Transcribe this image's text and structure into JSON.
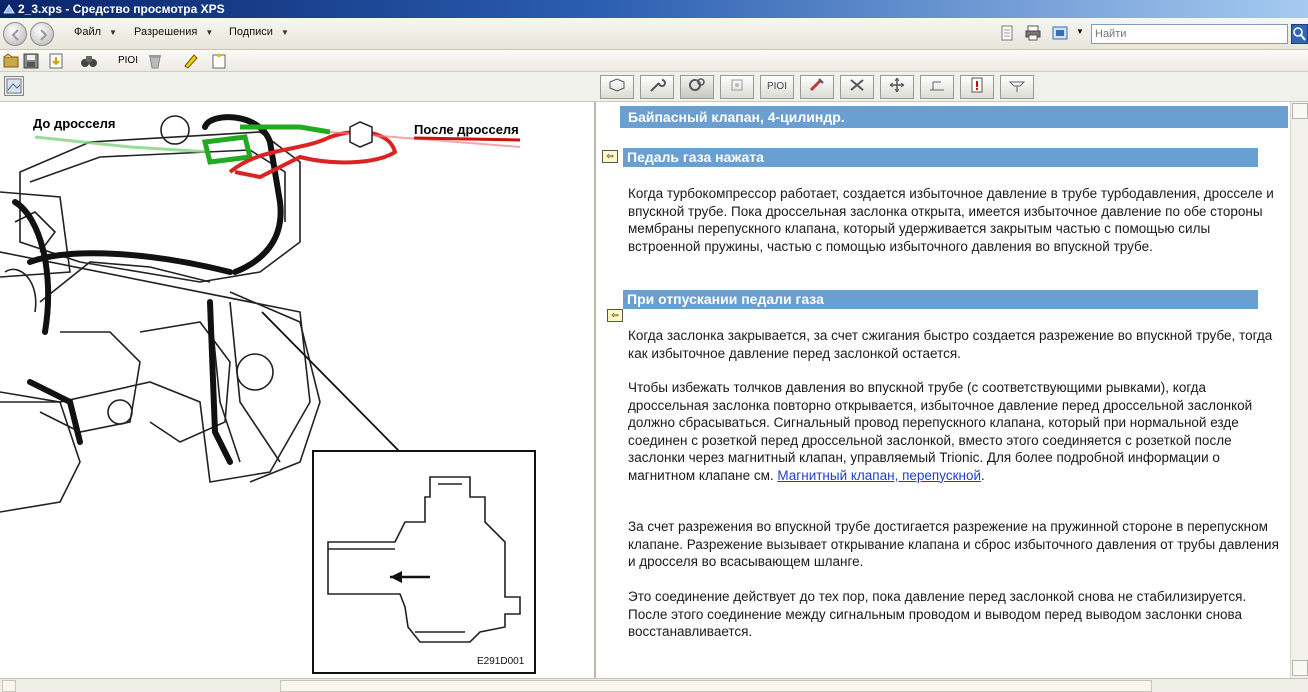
{
  "window": {
    "title": "2_3.xps - Средство просмотра XPS"
  },
  "menu": {
    "file": "Файл",
    "permissions": "Разрешения",
    "signatures": "Подписи"
  },
  "search": {
    "placeholder": "Найти"
  },
  "toolbar": {
    "piol_label": "PIOI"
  },
  "tabs": {
    "piol_label": "PIOI"
  },
  "diagram": {
    "before_throttle": "До дросселя",
    "after_throttle": "После дросселя",
    "figure_code": "E291D001"
  },
  "doc": {
    "title": "Байпасный клапан, 4-цилиндр.",
    "section1": {
      "heading": "Педаль газа нажата",
      "text": "Когда турбокомпрессор работает, создается избыточное давление в трубе турбодавления, дросселе и впускной трубе. Пока дроссельная заслонка открыта, имеется избыточное давление по обе стороны мембраны перепускного клапана, который удерживается закрытым частью с помощью силы встроенной пружины, частью с помощью избыточного давления во впускной трубе."
    },
    "section2": {
      "heading": "При отпускании педали газа",
      "p1": "Когда заслонка закрывается, за счет сжигания быстро создается разрежение во впускной трубе, тогда как избыточное давление перед заслонкой остается.",
      "p2_before_link": "Чтобы избежать толчков давления во впускной трубе (с соответствующими рывками), когда дроссельная заслонка повторно открывается, избыточное давление перед дроссельной заслонкой должно сбрасываться. Сигнальный провод перепускного клапана, который при нормальной езде соединен с розеткой перед дроссельной заслонкой, вместо этого соединяется с розеткой после заслонки через магнитный клапан, управляемый Trionic. Для более подробной информации о магнитном клапане см. ",
      "p2_link": "Магнитный клапан, перепускной",
      "p2_after_link": ".",
      "p3": "За счет разрежения во впускной трубе достигается разрежение на пружинной стороне в перепускном клапане. Разрежение вызывает открывание клапана и сброс избыточного давления от трубы давления и дросселя во всасывающем шланге.",
      "p4": "Это соединение действует до тех пор, пока давление перед заслонкой снова не стабилизируется. После этого соединение между сигнальным проводом и выводом перед выводом заслонки снова восстанавливается."
    }
  },
  "colors": {
    "accent": "#6a9fd2",
    "link": "#1f3fcf",
    "green_line": "#22aa22",
    "red_line": "#dd2222"
  }
}
